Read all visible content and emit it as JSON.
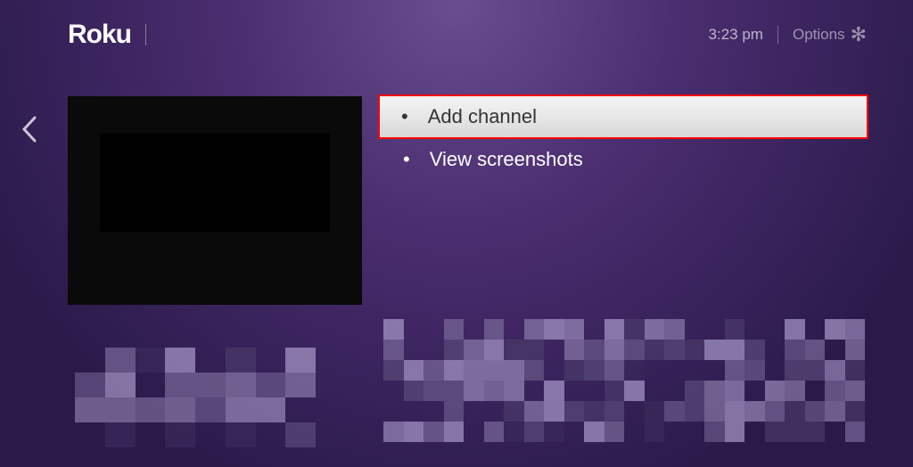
{
  "header": {
    "logo": "Roku",
    "time": "3:23 pm",
    "options_label": "Options"
  },
  "menu": {
    "items": [
      {
        "label": "Add channel",
        "selected": true
      },
      {
        "label": "View screenshots",
        "selected": false
      }
    ]
  }
}
